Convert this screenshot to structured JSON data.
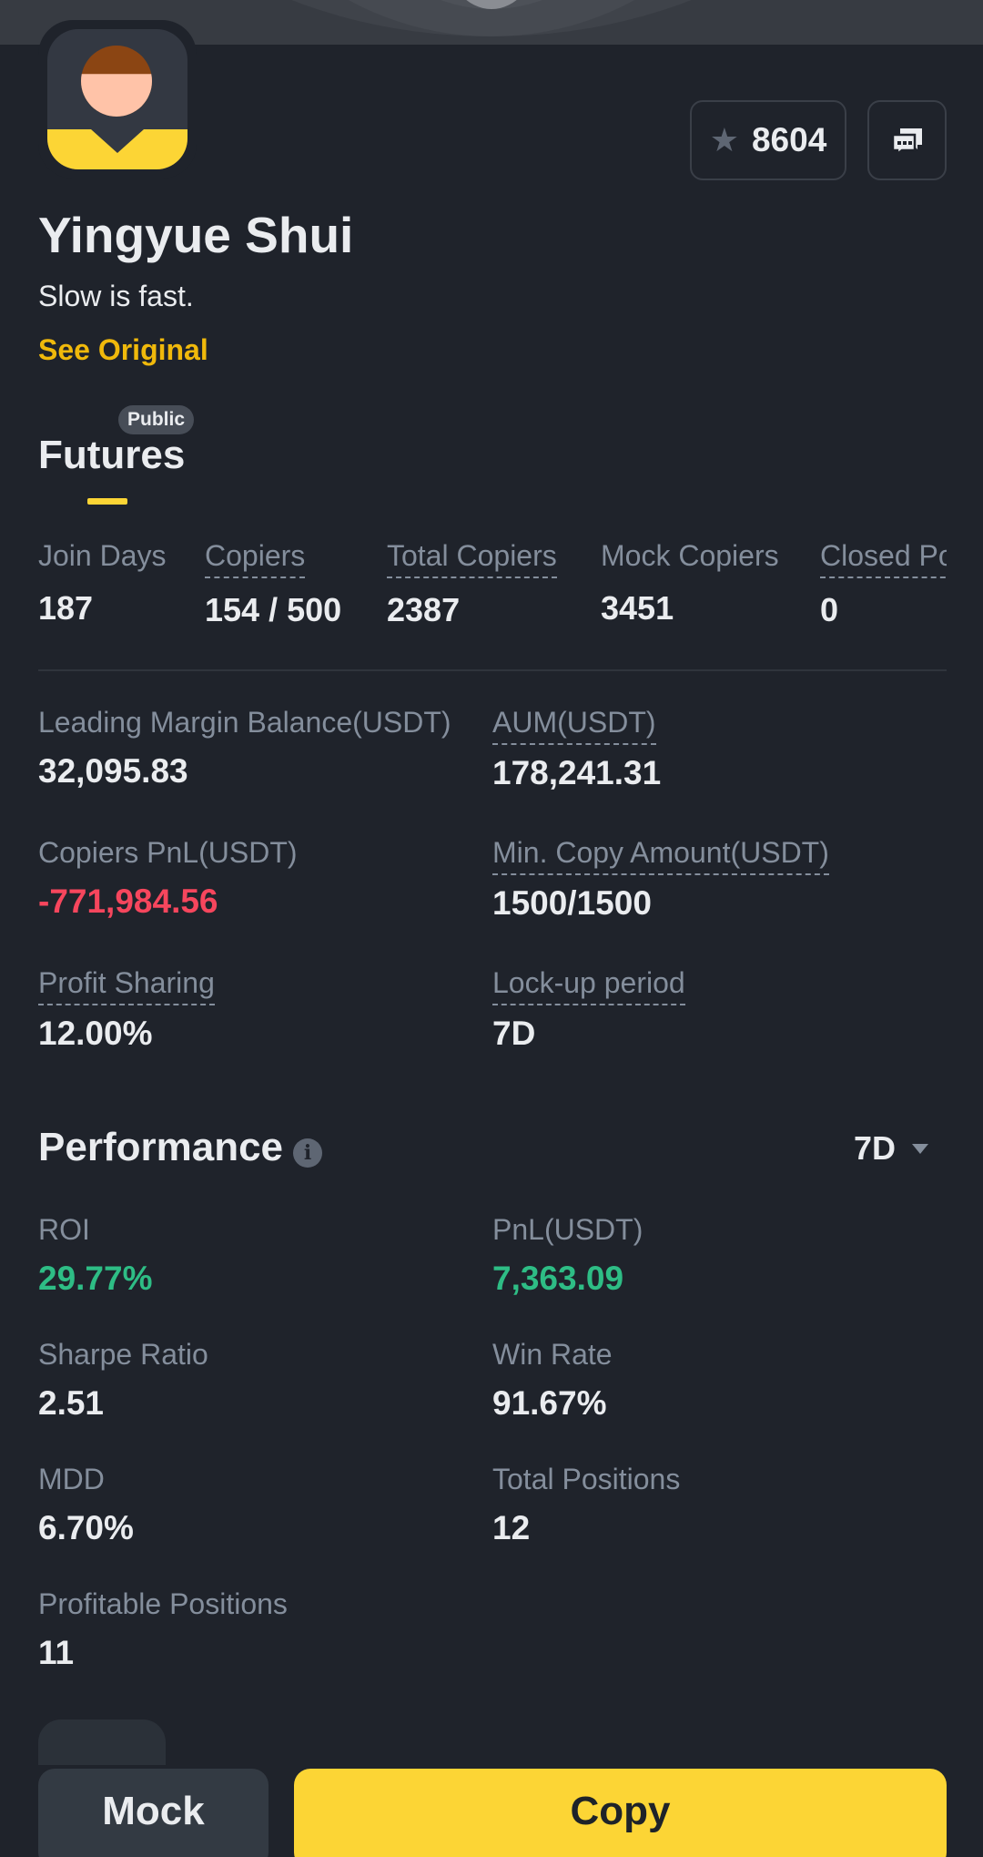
{
  "profile": {
    "name": "Yingyue Shui",
    "bio": "Slow is fast.",
    "see_original": "See Original",
    "favorites_count": "8604"
  },
  "tab": {
    "badge": "Public",
    "label": "Futures"
  },
  "stats": [
    {
      "label": "Join Days",
      "value": "187"
    },
    {
      "label": "Copiers",
      "value": "154 / 500"
    },
    {
      "label": "Total Copiers",
      "value": "2387"
    },
    {
      "label": "Mock Copiers",
      "value": "3451"
    },
    {
      "label": "Closed Po",
      "value": "0"
    }
  ],
  "details": [
    {
      "label": "Leading Margin Balance(USDT)",
      "value": "32,095.83"
    },
    {
      "label": "AUM(USDT)",
      "value": "178,241.31"
    },
    {
      "label": "Copiers PnL(USDT)",
      "value": "-771,984.56"
    },
    {
      "label": "Min. Copy Amount(USDT)",
      "value": "1500/1500"
    },
    {
      "label": "Profit Sharing",
      "value": "12.00%"
    },
    {
      "label": "Lock-up period",
      "value": "7D"
    }
  ],
  "performance": {
    "title": "Performance",
    "period": "7D",
    "items": [
      {
        "label": "ROI",
        "value": "29.77%"
      },
      {
        "label": "PnL(USDT)",
        "value": "7,363.09"
      },
      {
        "label": "Sharpe Ratio",
        "value": "2.51"
      },
      {
        "label": "Win Rate",
        "value": "91.67%"
      },
      {
        "label": "MDD",
        "value": "6.70%"
      },
      {
        "label": "Total Positions",
        "value": "12"
      },
      {
        "label": "Profitable Positions",
        "value": "11"
      }
    ]
  },
  "actions": {
    "mock": "Mock",
    "copy": "Copy"
  },
  "colors": {
    "background": "#1f232b",
    "accent_yellow": "#fcd535",
    "link_yellow": "#f0b90b",
    "negative": "#f6465d",
    "positive": "#2ebd85",
    "muted_text": "#848e9c"
  },
  "icons": {
    "favorite": "star-icon",
    "chat": "chat-icon",
    "info": "info-icon",
    "dropdown": "caret-down-icon"
  }
}
